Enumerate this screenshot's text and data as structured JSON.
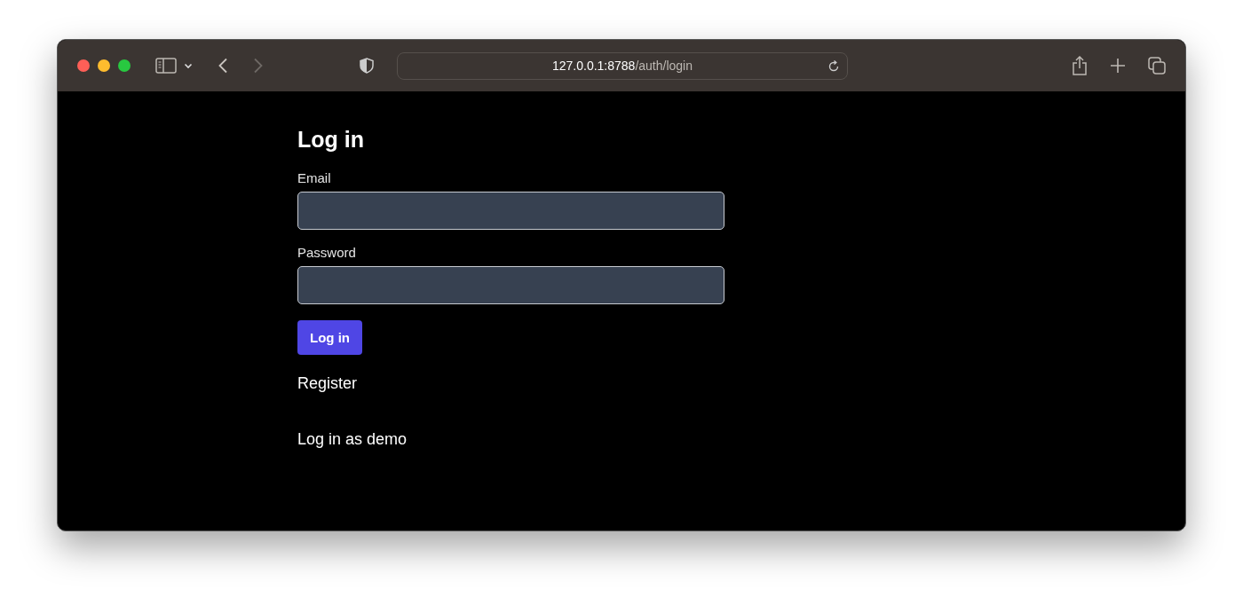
{
  "browser": {
    "address": "**127.0.0.1:8788**/auth/login",
    "back_disabled": false,
    "forward_disabled": true
  },
  "form": {
    "title": "Log in",
    "fields": [
      {
        "label": "Email"
      },
      {
        "label": "Password"
      }
    ],
    "submit": "Log in",
    "links": [
      "Register",
      "Log in as demo"
    ]
  }
}
